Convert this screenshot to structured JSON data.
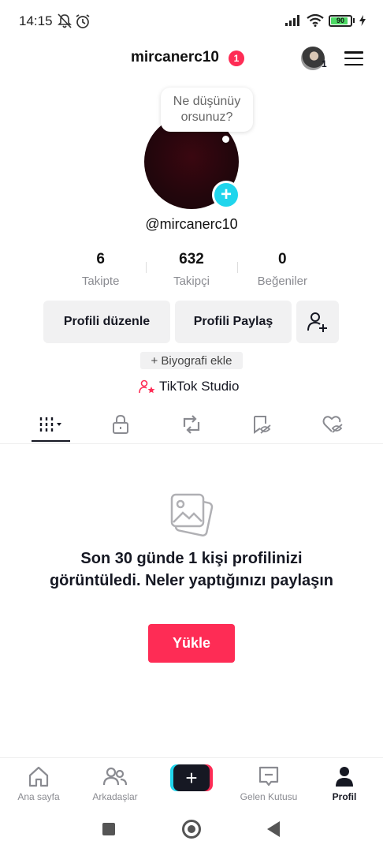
{
  "status_bar": {
    "time": "14:15",
    "battery_level": 90,
    "battery_label": "90"
  },
  "header": {
    "username": "mircanerc10",
    "notification_badge": "1",
    "account_switch_count": "1"
  },
  "profile": {
    "bubble_text": "Ne düşünüy orsunuz?",
    "handle": "@mircanerc10",
    "stats": [
      {
        "value": "6",
        "label": "Takipte"
      },
      {
        "value": "632",
        "label": "Takipçi"
      },
      {
        "value": "0",
        "label": "Beğeniler"
      }
    ],
    "edit_profile_label": "Profili düzenle",
    "share_profile_label": "Profili Paylaş",
    "add_bio_label": "+ Biyografi ekle",
    "studio_label": "TikTok Studio"
  },
  "empty_state": {
    "message": "Son 30 günde 1 kişi profilinizi görüntüledi. Neler yaptığınızı paylaşın",
    "upload_label": "Yükle"
  },
  "bottom_nav": {
    "home": "Ana sayfa",
    "friends": "Arkadaşlar",
    "inbox": "Gelen Kutusu",
    "profile": "Profil"
  },
  "colors": {
    "accent": "#fe2c55",
    "cyan": "#20d5ec",
    "text": "#161823",
    "muted": "#8a8b91"
  }
}
